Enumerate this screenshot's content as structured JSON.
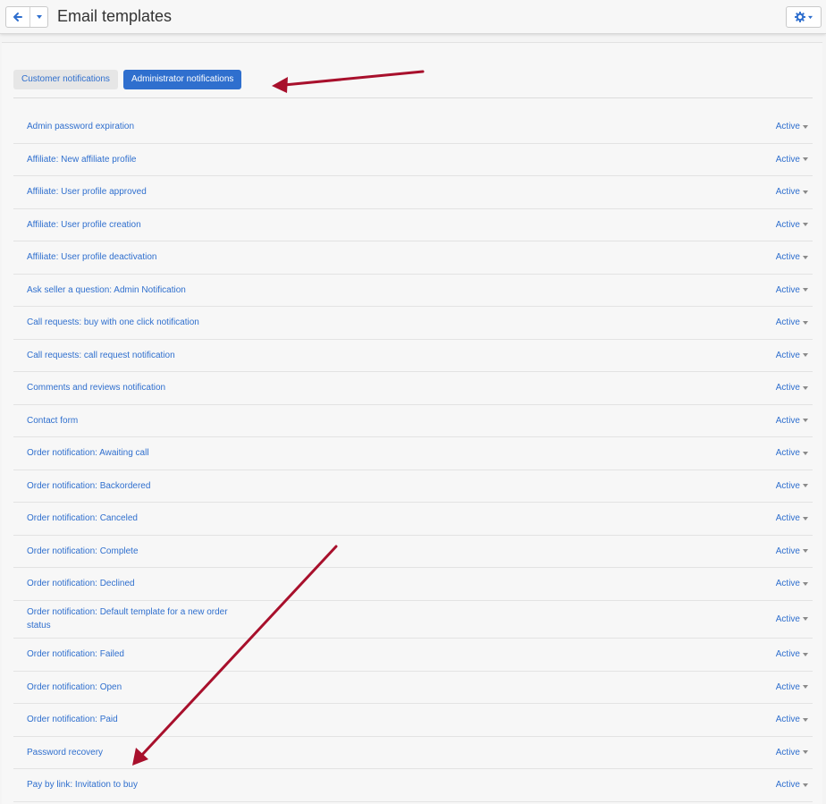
{
  "header": {
    "title": "Email templates"
  },
  "tabs": [
    {
      "label": "Customer notifications"
    },
    {
      "label": "Administrator notifications"
    }
  ],
  "status_label": "Active",
  "templates": [
    {
      "label": "Admin password expiration"
    },
    {
      "label": "Affiliate: New affiliate profile"
    },
    {
      "label": "Affiliate: User profile approved"
    },
    {
      "label": "Affiliate: User profile creation"
    },
    {
      "label": "Affiliate: User profile deactivation"
    },
    {
      "label": "Ask seller a question: Admin Notification"
    },
    {
      "label": "Call requests: buy with one click notification"
    },
    {
      "label": "Call requests: call request notification"
    },
    {
      "label": "Comments and reviews notification"
    },
    {
      "label": "Contact form"
    },
    {
      "label": "Order notification: Awaiting call"
    },
    {
      "label": "Order notification: Backordered"
    },
    {
      "label": "Order notification: Canceled"
    },
    {
      "label": "Order notification: Complete"
    },
    {
      "label": "Order notification: Declined"
    },
    {
      "label": "Order notification: Default template for a new order status"
    },
    {
      "label": "Order notification: Failed"
    },
    {
      "label": "Order notification: Open"
    },
    {
      "label": "Order notification: Paid"
    },
    {
      "label": "Password recovery"
    },
    {
      "label": "Pay by link: Invitation to buy"
    }
  ],
  "colors": {
    "accent": "#2f6fce",
    "annotation_arrow": "#a8102c"
  },
  "icons": {
    "back": "arrow-left-icon",
    "dropdown": "caret-down-icon",
    "settings": "gear-icon"
  }
}
